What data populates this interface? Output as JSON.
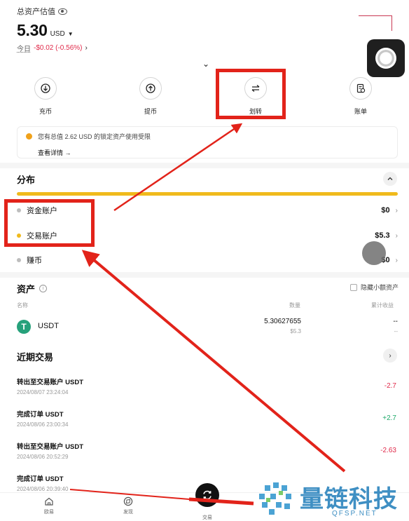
{
  "header": {
    "est_label": "总资产估值",
    "balance": "5.30",
    "currency": "USD",
    "today_label": "今日",
    "today_change": "-$0.02 (-0.56%)"
  },
  "actions": [
    {
      "label": "充币",
      "icon": "download-icon"
    },
    {
      "label": "提币",
      "icon": "upload-icon"
    },
    {
      "label": "划转",
      "icon": "transfer-icon"
    },
    {
      "label": "账单",
      "icon": "bill-icon"
    }
  ],
  "notice": {
    "text": "您有总值 2.62 USD 的锁定资产使用受限",
    "link": "查看详情 →"
  },
  "distribution": {
    "title": "分布",
    "accounts": [
      {
        "name": "资金账户",
        "value": "$0",
        "color": "#bdbdbd"
      },
      {
        "name": "交易账户",
        "value": "$5.3",
        "color": "#f0ba1c"
      },
      {
        "name": "赚币",
        "value": "$0",
        "color": "#bdbdbd"
      }
    ]
  },
  "assets": {
    "title": "资产",
    "hide_small": "隐藏小额资产",
    "col_name": "名称",
    "col_qty": "数量",
    "col_pnl": "累计收益",
    "rows": [
      {
        "name": "USDT",
        "qty": "5.30627655",
        "usd": "$5.3",
        "pnl": "--",
        "pnl2": "--"
      }
    ]
  },
  "recent": {
    "title": "近期交易",
    "items": [
      {
        "title": "转出至交易账户 USDT",
        "time": "2024/08/07 23:24:04",
        "amount": "-2.7",
        "color": "#e02a4a"
      },
      {
        "title": "完成订单 USDT",
        "time": "2024/08/06 23:00:34",
        "amount": "+2.7",
        "color": "#1ea96a"
      },
      {
        "title": "转出至交易账户 USDT",
        "time": "2024/08/06 20:52:29",
        "amount": "-2.63",
        "color": "#e02a4a"
      },
      {
        "title": "完成订单 USDT",
        "time": "2024/08/06 20:39:40",
        "amount": "",
        "color": "#1ea96a"
      }
    ]
  },
  "nav": [
    {
      "label": "欧易"
    },
    {
      "label": "发现"
    },
    {
      "label": "交易"
    }
  ],
  "watermark": {
    "text": "量链科技",
    "url": "QFSP.NET"
  },
  "colors": {
    "annotation": "#e2231a",
    "accent": "#f0ba1c",
    "down": "#e02a4a",
    "up": "#1ea96a"
  }
}
